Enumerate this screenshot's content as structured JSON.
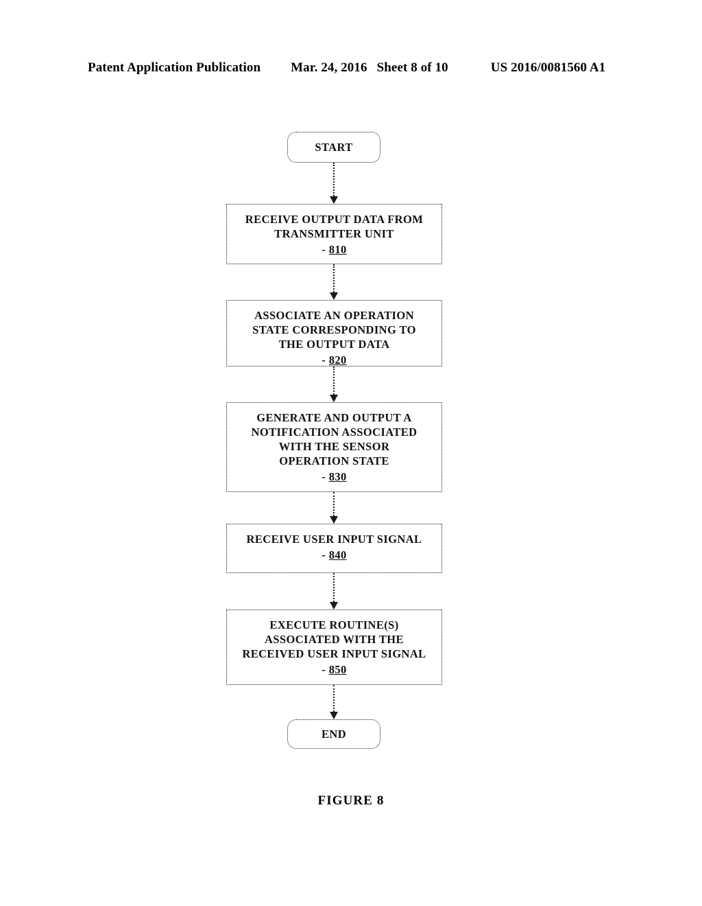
{
  "header": {
    "publication": "Patent Application Publication",
    "date": "Mar. 24, 2016",
    "sheet": "Sheet 8 of 10",
    "patent_number": "US 2016/0081560 A1"
  },
  "caption": {
    "figure_label": "FIGURE 8"
  },
  "colors": {
    "ink": "#111111",
    "border": "#1a1a1a",
    "background": "#ffffff"
  },
  "flowchart": {
    "type": "flowchart",
    "orientation": "top-to-bottom",
    "nodes": [
      {
        "id": "start",
        "shape": "rounded-rectangle",
        "label": "START",
        "ref": null,
        "ref_dash": null
      },
      {
        "id": "step-810",
        "shape": "rectangle",
        "label": "RECEIVE OUTPUT DATA FROM TRANSMITTER UNIT",
        "line1": "RECEIVE OUTPUT DATA FROM",
        "line2": "TRANSMITTER UNIT",
        "ref": "810",
        "ref_dash": "-"
      },
      {
        "id": "step-820",
        "shape": "rectangle",
        "label": "ASSOCIATE AN OPERATION STATE CORRESPONDING TO THE OUTPUT DATA",
        "line1": "ASSOCIATE AN OPERATION",
        "line2": "STATE CORRESPONDING TO",
        "line3": "THE OUTPUT DATA",
        "ref": "820",
        "ref_dash": "-"
      },
      {
        "id": "step-830",
        "shape": "rectangle",
        "label": "GENERATE AND OUTPUT A NOTIFICATION ASSOCIATED WITH THE SENSOR OPERATION STATE",
        "line1": "GENERATE AND OUTPUT A",
        "line2": "NOTIFICATION ASSOCIATED",
        "line3": "WITH THE SENSOR",
        "line4": "OPERATION STATE",
        "ref": "830",
        "ref_dash": "-"
      },
      {
        "id": "step-840",
        "shape": "rectangle",
        "label": "RECEIVE USER INPUT SIGNAL",
        "line1": "RECEIVE USER INPUT SIGNAL",
        "ref": "840",
        "ref_dash": "-"
      },
      {
        "id": "step-850",
        "shape": "rectangle",
        "label": "EXECUTE ROUTINE(S) ASSOCIATED WITH THE RECEIVED USER INPUT SIGNAL",
        "line1": "EXECUTE ROUTINE(S)",
        "line2": "ASSOCIATED WITH THE",
        "line3": "RECEIVED USER INPUT SIGNAL",
        "ref": "850",
        "ref_dash": "-"
      },
      {
        "id": "end",
        "shape": "rounded-rectangle",
        "label": "END",
        "ref": null,
        "ref_dash": null
      }
    ],
    "edges": [
      {
        "from": "start",
        "to": "step-810",
        "style": "dotted-arrow"
      },
      {
        "from": "step-810",
        "to": "step-820",
        "style": "dotted-arrow"
      },
      {
        "from": "step-820",
        "to": "step-830",
        "style": "dotted-arrow"
      },
      {
        "from": "step-830",
        "to": "step-840",
        "style": "dotted-arrow"
      },
      {
        "from": "step-840",
        "to": "step-850",
        "style": "dotted-arrow"
      },
      {
        "from": "step-850",
        "to": "end",
        "style": "dotted-arrow"
      }
    ]
  }
}
